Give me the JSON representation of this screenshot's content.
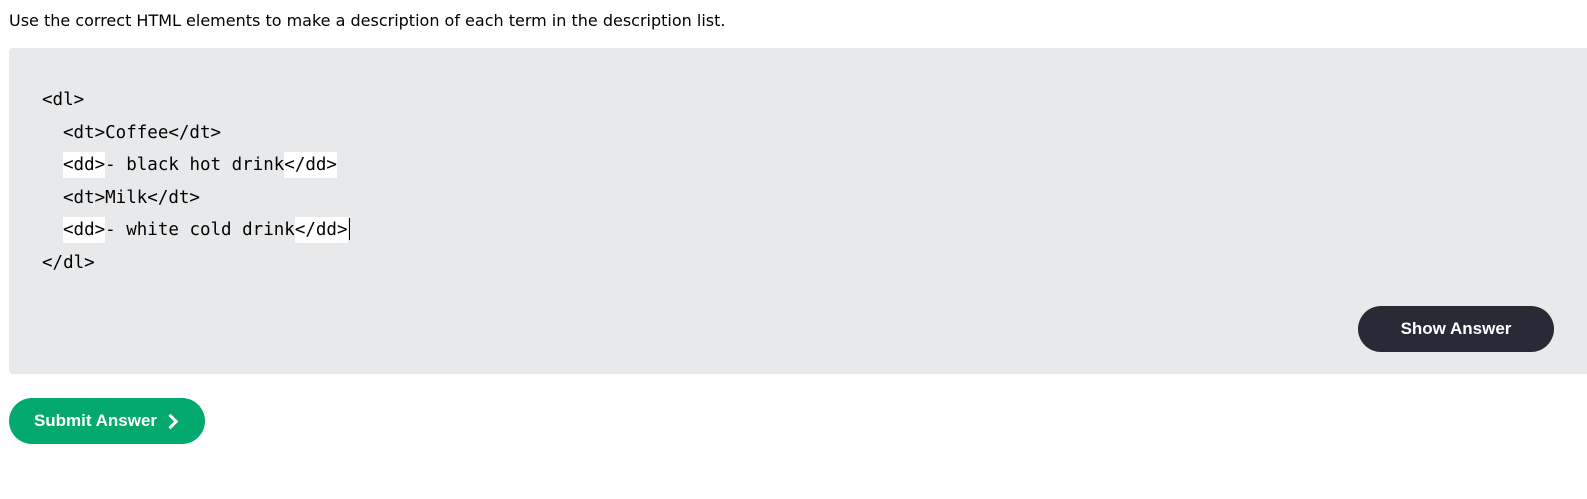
{
  "instruction": "Use the correct HTML elements to make a description of each term in the description list.",
  "code": {
    "line1": "<dl>",
    "line2": "<dt>Coffee</dt>",
    "line3": {
      "open_tag": "<dd>",
      "content": "- black hot drink",
      "close_tag": "</dd>"
    },
    "line4": "<dt>Milk</dt>",
    "line5": {
      "open_tag": "<dd>",
      "content": "- white cold drink",
      "close_tag": "</dd>"
    },
    "line6": "</dl>"
  },
  "buttons": {
    "show_answer": "Show Answer",
    "submit_answer": "Submit Answer"
  },
  "colors": {
    "panel_background": "#e7e9eb",
    "show_answer_background": "#282a35",
    "submit_background": "#04aa6d",
    "blank_background": "#ffffff"
  },
  "icons": {
    "submit": "chevron-right-icon"
  }
}
